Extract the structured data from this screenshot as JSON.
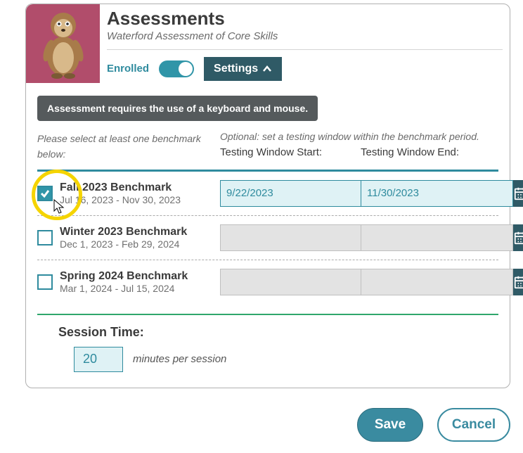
{
  "header": {
    "title": "Assessments",
    "subtitle": "Waterford Assessment of Core Skills",
    "enrolled_label": "Enrolled",
    "settings_label": "Settings"
  },
  "notice": "Assessment requires the use of a keyboard and mouse.",
  "left_instruction": "Please select at least one benchmark below:",
  "right_instruction": "Optional: set a testing window within the benchmark period.",
  "window_start_label": "Testing Window Start:",
  "window_end_label": "Testing Window End:",
  "benchmarks": [
    {
      "name": "Fall 2023 Benchmark",
      "dates": "Jul 16, 2023 - Nov 30, 2023",
      "checked": true,
      "start": "9/22/2023",
      "end": "11/30/2023"
    },
    {
      "name": "Winter 2023 Benchmark",
      "dates": "Dec 1, 2023 - Feb 29, 2024",
      "checked": false,
      "start": "",
      "end": ""
    },
    {
      "name": "Spring 2024 Benchmark",
      "dates": "Mar 1, 2024 - Jul 15, 2024",
      "checked": false,
      "start": "",
      "end": ""
    }
  ],
  "session": {
    "title": "Session Time:",
    "value": "20",
    "unit": "minutes per session"
  },
  "buttons": {
    "save": "Save",
    "cancel": "Cancel"
  }
}
